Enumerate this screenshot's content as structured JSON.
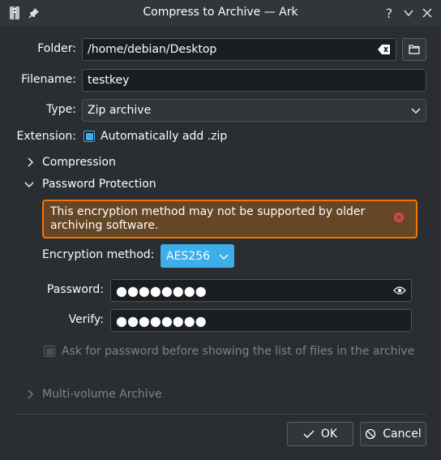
{
  "window": {
    "title": "Compress to Archive — Ark",
    "help_glyph": "?"
  },
  "form": {
    "folder_label": "Folder:",
    "folder_value": "/home/debian/Desktop",
    "filename_label": "Filename:",
    "filename_value": "testkey",
    "type_label": "Type:",
    "type_value": "Zip archive",
    "extension_label": "Extension:",
    "extension_checkbox_label": "Automatically add .zip",
    "extension_checked": true
  },
  "sections": {
    "compression": "Compression",
    "password_protection": "Password Protection",
    "multi_volume": "Multi-volume Archive"
  },
  "password": {
    "warning": "This encryption method may not be supported by older archiving software.",
    "encryption_label": "Encryption method:",
    "encryption_value": "AES256",
    "password_label": "Password:",
    "password_mask": "●●●●●●●●",
    "verify_label": "Verify:",
    "verify_mask": "●●●●●●●●",
    "ask_password_label": "Ask for password before showing the list of files in the archive",
    "ask_password_checked": false
  },
  "buttons": {
    "ok": "OK",
    "cancel": "Cancel"
  },
  "colors": {
    "window_bg": "#2a2e32",
    "field_bg": "#1b1e20",
    "accent": "#3daee9",
    "warning_border": "#f67400",
    "warning_bg": "#654726",
    "error_icon": "#da4453"
  }
}
